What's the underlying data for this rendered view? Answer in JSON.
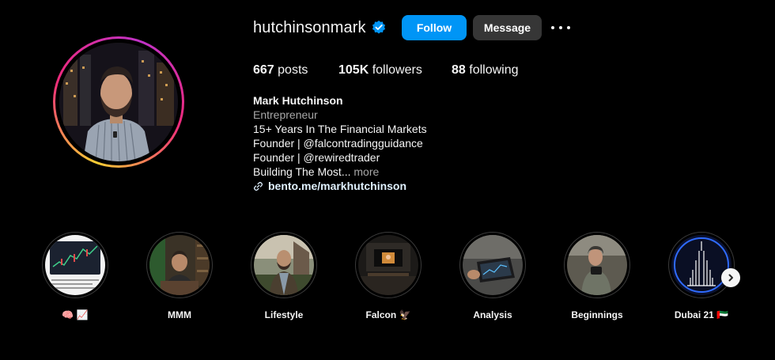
{
  "profile": {
    "username": "hutchinsonmark",
    "verified": true,
    "follow_label": "Follow",
    "message_label": "Message",
    "more_icon": "ellipsis-icon"
  },
  "stats": {
    "posts_count": "667",
    "posts_label": "posts",
    "followers_count": "105K",
    "followers_label": "followers",
    "following_count": "88",
    "following_label": "following"
  },
  "bio": {
    "name": "Mark Hutchinson",
    "category": "Entrepreneur",
    "lines": [
      "15+ Years In The Financial Markets",
      "Founder | @falcontradingguidance",
      "Founder | @rewiredtrader"
    ],
    "truncated": "Building The Most...",
    "more_label": "more",
    "link": "bento.me/markhutchinson",
    "link_icon": "link-icon"
  },
  "highlights": [
    {
      "label": "🧠 📈"
    },
    {
      "label": "MMM"
    },
    {
      "label": "Lifestyle"
    },
    {
      "label": "Falcon 🦅"
    },
    {
      "label": "Analysis"
    },
    {
      "label": "Beginnings"
    },
    {
      "label": "Dubai 21 🇦🇪"
    }
  ],
  "colors": {
    "background": "#000000",
    "follow_button": "#0095f6",
    "message_button": "#363636",
    "verified_badge": "#0095f6",
    "secondary_text": "#a8a8a8",
    "link_text": "#e0f1ff"
  }
}
